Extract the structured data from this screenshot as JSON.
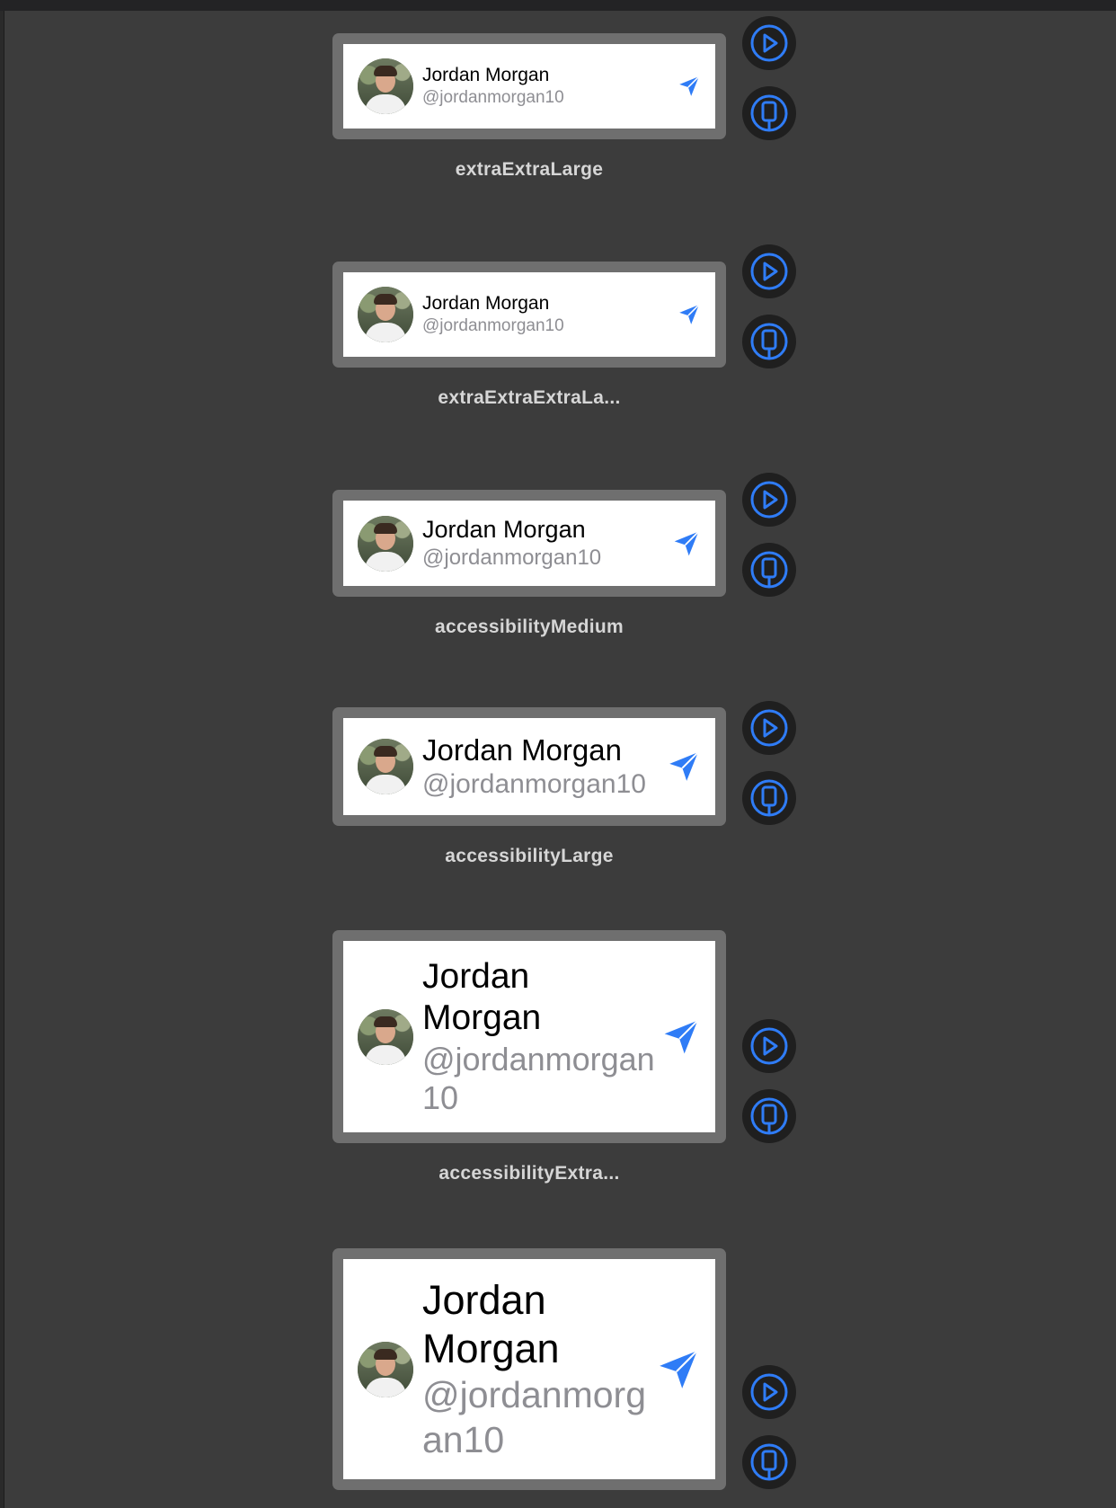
{
  "previews": [
    {
      "name": "Jordan Morgan",
      "handle": "@jordanmorgan10",
      "size_label": "extraExtraLarge"
    },
    {
      "name": "Jordan Morgan",
      "handle": "@jordanmorgan10",
      "size_label": "extraExtraExtraLa..."
    },
    {
      "name": "Jordan Morgan",
      "handle": "@jordanmorgan10",
      "size_label": "accessibilityMedium"
    },
    {
      "name": "Jordan Morgan",
      "handle": "@jordanmorgan10",
      "size_label": "accessibilityLarge"
    },
    {
      "name_lines": [
        "Jordan",
        "Morgan"
      ],
      "handle_lines": [
        "@jordanmorgan",
        "10"
      ],
      "size_label": "accessibilityExtra..."
    },
    {
      "name_lines": [
        "Jordan",
        "Morgan"
      ],
      "handle_lines": [
        "@jordanmorg",
        "an10"
      ]
    }
  ],
  "controls": {
    "live_icon": "play-circle-icon",
    "device_icon": "device-preview-icon",
    "accent": "#2f7cf6"
  },
  "icons": {
    "send": "send-paper-plane-icon"
  }
}
